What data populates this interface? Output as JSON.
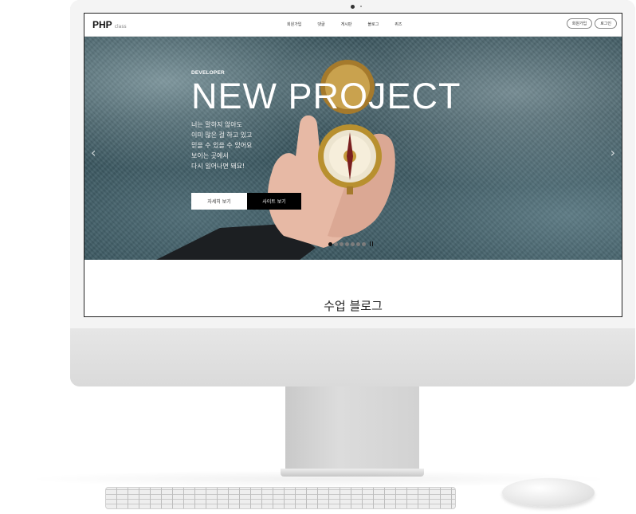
{
  "site": {
    "logo": "PHP",
    "logo_sub": "class",
    "nav": [
      "회원가입",
      "댓글",
      "게시판",
      "블로그",
      "퀴즈"
    ],
    "auth": {
      "signup": "회원가입",
      "login": "로그인"
    }
  },
  "hero": {
    "kicker": "DEVELOPER",
    "title": "NEW PROJECT",
    "desc_lines": [
      "너는 말하지 않아도",
      "이미 많은 걸 하고 있고",
      "믿을 수 있을 수 있어요",
      "보이는 곳에서",
      "다시 일어나면 돼요!"
    ],
    "btn_detail": "자세히 보기",
    "btn_site": "사이트 보기",
    "slides": {
      "count": 7,
      "active_index": 0
    }
  },
  "section": {
    "title": "수업 블로그"
  }
}
